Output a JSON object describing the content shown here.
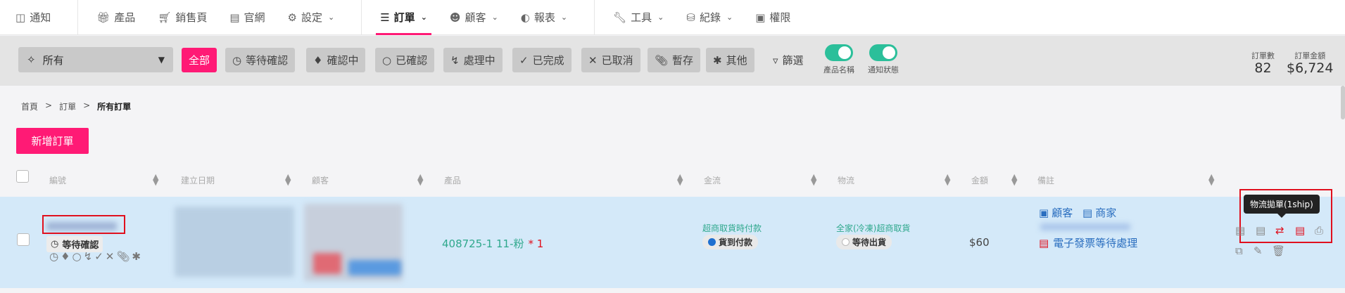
{
  "topnav": {
    "items": [
      {
        "label": "通知",
        "icon": "inbox-icon"
      },
      {
        "label": "產品",
        "icon": "gift-icon"
      },
      {
        "label": "銷售頁",
        "icon": "cart-icon"
      },
      {
        "label": "官網",
        "icon": "store-icon"
      },
      {
        "label": "設定",
        "icon": "gear-icon"
      },
      {
        "label": "訂單",
        "icon": "list-icon"
      },
      {
        "label": "顧客",
        "icon": "users-icon"
      },
      {
        "label": "報表",
        "icon": "chart-icon"
      },
      {
        "label": "工具",
        "icon": "wrench-icon"
      },
      {
        "label": "紀錄",
        "icon": "database-icon"
      },
      {
        "label": "權限",
        "icon": "clipboard-icon"
      }
    ],
    "active": "訂單"
  },
  "filter": {
    "scope": "所有",
    "buttons": [
      {
        "label": "全部",
        "icon": ""
      },
      {
        "label": "等待確認",
        "icon": "clock-icon"
      },
      {
        "label": "確認中",
        "icon": "bell-icon"
      },
      {
        "label": "已確認",
        "icon": "circle-icon"
      },
      {
        "label": "處理中",
        "icon": "bolt-icon"
      },
      {
        "label": "已完成",
        "icon": "check-icon"
      },
      {
        "label": "已取消",
        "icon": "x-icon"
      },
      {
        "label": "暫存",
        "icon": "paperclip-icon"
      },
      {
        "label": "其他",
        "icon": "asterisk-icon"
      }
    ],
    "filter_label": "篩選",
    "toggles": [
      {
        "label": "產品名稱",
        "on": true
      },
      {
        "label": "通知狀態",
        "on": true
      }
    ],
    "stats": [
      {
        "label": "訂單數",
        "value": "82"
      },
      {
        "label": "訂單金額",
        "value": "$6,724"
      }
    ],
    "accent": "#ff1a75",
    "toggle_color": "#2bbf9a"
  },
  "breadcrumb": [
    "首頁",
    "訂單",
    "所有訂單"
  ],
  "add_order_label": "新增訂單",
  "table": {
    "columns": [
      "編號",
      "建立日期",
      "顧客",
      "產品",
      "金流",
      "物流",
      "金額",
      "備註"
    ],
    "row": {
      "status": "等待確認",
      "product": "408725-1 11-粉",
      "qty": "* 1",
      "payment_method": "超商取貨時付款",
      "payment_status": "貨到付款",
      "logistics_method": "全家(冷凍)超商取貨",
      "logistics_status": "等待出貨",
      "amount": "$60",
      "note_customer": "顧客",
      "note_merchant": "商家",
      "invoice": "電子發票等待處理",
      "tooltip": "物流拋單(1ship)"
    }
  }
}
